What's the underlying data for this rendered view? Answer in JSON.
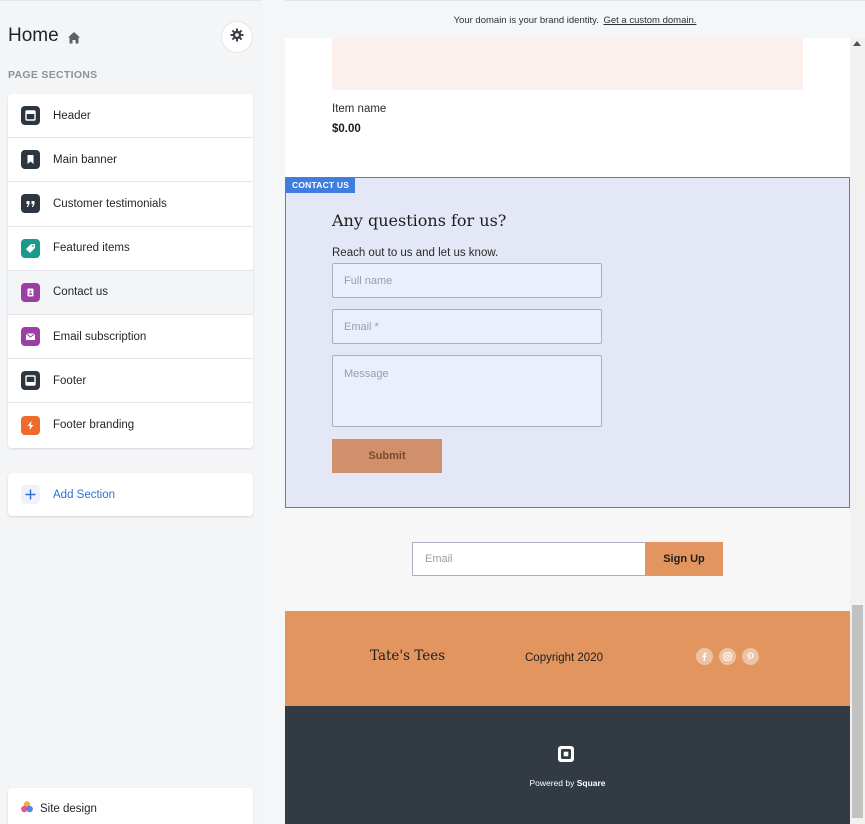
{
  "sidebar": {
    "title": "Home",
    "sections_label": "PAGE SECTIONS",
    "items": [
      {
        "label": "Header",
        "icon": "header-icon",
        "color": "#2d3640"
      },
      {
        "label": "Main banner",
        "icon": "bookmark-icon",
        "color": "#2d3640"
      },
      {
        "label": "Customer testimonials",
        "icon": "quote-icon",
        "color": "#2d3640"
      },
      {
        "label": "Featured items",
        "icon": "tag-icon",
        "color": "#1a9a8a"
      },
      {
        "label": "Contact us",
        "icon": "contact-icon",
        "color": "#9b3fa5"
      },
      {
        "label": "Email subscription",
        "icon": "mail-icon",
        "color": "#9b3fa5"
      },
      {
        "label": "Footer",
        "icon": "footer-icon",
        "color": "#2d3640"
      },
      {
        "label": "Footer branding",
        "icon": "bolt-icon",
        "color": "#f06a2c"
      }
    ],
    "add_section_label": "Add Section",
    "site_design_label": "Site design"
  },
  "domain_bar": {
    "text": "Your domain is your brand identity.",
    "link": "Get a custom domain."
  },
  "preview": {
    "item": {
      "name": "Item name",
      "price": "$0.00"
    },
    "contact": {
      "tag": "CONTACT US",
      "heading": "Any questions for us?",
      "subtitle": "Reach out to us and let us know.",
      "name_placeholder": "Full name",
      "email_placeholder": "Email *",
      "message_placeholder": "Message",
      "submit_label": "Submit"
    },
    "subscribe": {
      "email_placeholder": "Email",
      "button_label": "Sign Up"
    },
    "footer": {
      "brand": "Tate's Tees",
      "copyright": "Copyright 2020",
      "social": [
        "facebook-icon",
        "instagram-icon",
        "pinterest-icon"
      ]
    },
    "branding": {
      "powered_prefix": "Powered by",
      "powered_brand": "Square"
    }
  },
  "colors": {
    "accent_blue": "#3f7de0",
    "orange": "#e2955f",
    "dark_footer": "#323a43"
  }
}
